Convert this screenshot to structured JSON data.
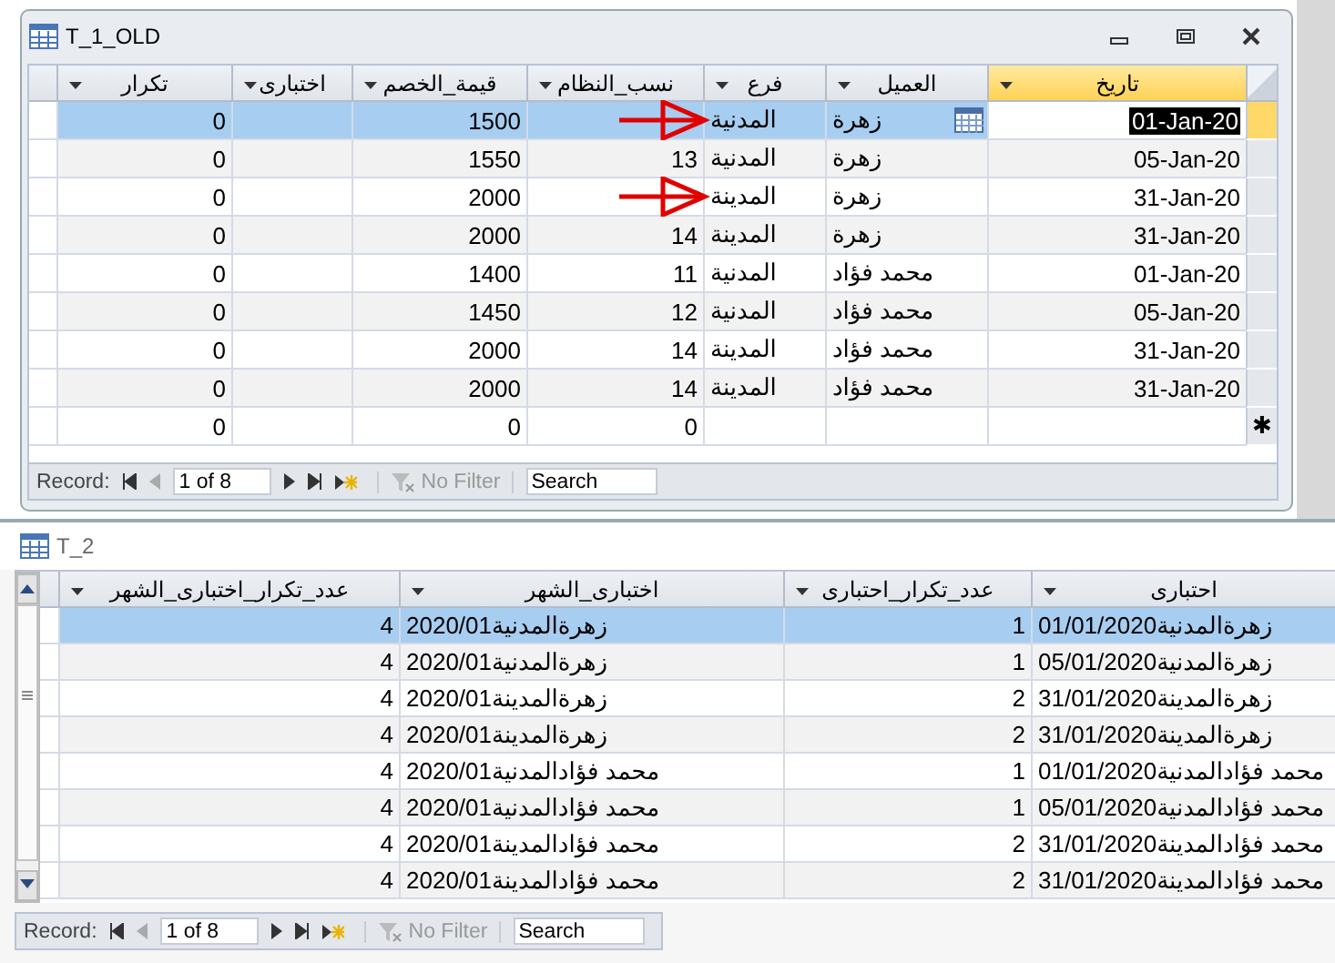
{
  "table_window": {
    "title": "T_1_OLD",
    "columns": [
      {
        "label": "تاريخ",
        "kind": "date",
        "active": true
      },
      {
        "label": "العميل",
        "kind": "text",
        "active": false
      },
      {
        "label": "فرع",
        "kind": "text",
        "active": false
      },
      {
        "label": "نسب_النظام",
        "kind": "number",
        "active": false
      },
      {
        "label": "قيمة_الخصم",
        "kind": "number",
        "active": false
      },
      {
        "label": "اختبارى",
        "kind": "text",
        "active": false
      },
      {
        "label": "تكرار",
        "kind": "number",
        "active": false
      }
    ],
    "rows": [
      {
        "kind": "record",
        "selected": true,
        "marked": true,
        "cells": [
          "01-Jan-20",
          "زهرة",
          "المدنية",
          null,
          "1500",
          null,
          "0"
        ]
      },
      {
        "kind": "record",
        "selected": false,
        "marked": false,
        "cells": [
          "05-Jan-20",
          "زهرة",
          "المدنية",
          "13",
          "1550",
          null,
          "0"
        ]
      },
      {
        "kind": "record",
        "selected": false,
        "marked": true,
        "cells": [
          "31-Jan-20",
          "زهرة",
          "المدينة",
          null,
          "2000",
          null,
          "0"
        ]
      },
      {
        "kind": "record",
        "selected": false,
        "marked": false,
        "cells": [
          "31-Jan-20",
          "زهرة",
          "المدينة",
          "14",
          "2000",
          null,
          "0"
        ]
      },
      {
        "kind": "record",
        "selected": false,
        "marked": false,
        "cells": [
          "01-Jan-20",
          "محمد فؤاد",
          "المدنية",
          "11",
          "1400",
          null,
          "0"
        ]
      },
      {
        "kind": "record",
        "selected": false,
        "marked": false,
        "cells": [
          "05-Jan-20",
          "محمد فؤاد",
          "المدنية",
          "12",
          "1450",
          null,
          "0"
        ]
      },
      {
        "kind": "record",
        "selected": false,
        "marked": false,
        "cells": [
          "31-Jan-20",
          "محمد فؤاد",
          "المدينة",
          "14",
          "2000",
          null,
          "0"
        ]
      },
      {
        "kind": "record",
        "selected": false,
        "marked": false,
        "cells": [
          "31-Jan-20",
          "محمد فؤاد",
          "المدينة",
          "14",
          "2000",
          null,
          "0"
        ]
      },
      {
        "kind": "new",
        "marker": "✱",
        "selected": false,
        "marked": false,
        "cells": [
          null,
          null,
          null,
          "0",
          "0",
          null,
          "0"
        ]
      }
    ],
    "navigator": {
      "label": "Record:",
      "position": "1 of 8",
      "filter": "No Filter",
      "search": {
        "placeholder": "Search"
      }
    }
  },
  "query_window": {
    "title": "T_2",
    "columns": [
      {
        "label": "احتبارى",
        "kind": "text",
        "active": false
      },
      {
        "label": "عدد_تكرار_احتبارى",
        "kind": "number",
        "active": false
      },
      {
        "label": "اختبارى_الشهر",
        "kind": "text",
        "active": false
      },
      {
        "label": "عدد_تكرار_اختبارى_الشهر",
        "kind": "number",
        "active": false
      }
    ],
    "rows": [
      {
        "selected": true,
        "cells": [
          "زهرةالمدنية01/01/2020",
          "1",
          "زهرةالمدنية2020/01",
          "4"
        ]
      },
      {
        "selected": false,
        "cells": [
          "زهرةالمدنية05/01/2020",
          "1",
          "زهرةالمدنية2020/01",
          "4"
        ]
      },
      {
        "selected": false,
        "cells": [
          "زهرةالمدينة31/01/2020",
          "2",
          "زهرةالمدينة2020/01",
          "4"
        ]
      },
      {
        "selected": false,
        "cells": [
          "زهرةالمدينة31/01/2020",
          "2",
          "زهرةالمدينة2020/01",
          "4"
        ]
      },
      {
        "selected": false,
        "cells": [
          "محمد فؤادالمدنية01/01/2020",
          "1",
          "محمد فؤادالمدنية2020/01",
          "4"
        ]
      },
      {
        "selected": false,
        "cells": [
          "محمد فؤادالمدنية05/01/2020",
          "1",
          "محمد فؤادالمدنية2020/01",
          "4"
        ]
      },
      {
        "selected": false,
        "cells": [
          "محمد فؤادالمدينة31/01/2020",
          "2",
          "محمد فؤادالمدينة2020/01",
          "4"
        ]
      },
      {
        "selected": false,
        "cells": [
          "محمد فؤادالمدينة31/01/2020",
          "2",
          "محمد فؤادالمدينة2020/01",
          "4"
        ]
      }
    ],
    "navigator": {
      "label": "Record:",
      "position": "1 of 8",
      "filter": "No Filter",
      "search": {
        "placeholder": "Search"
      }
    }
  }
}
